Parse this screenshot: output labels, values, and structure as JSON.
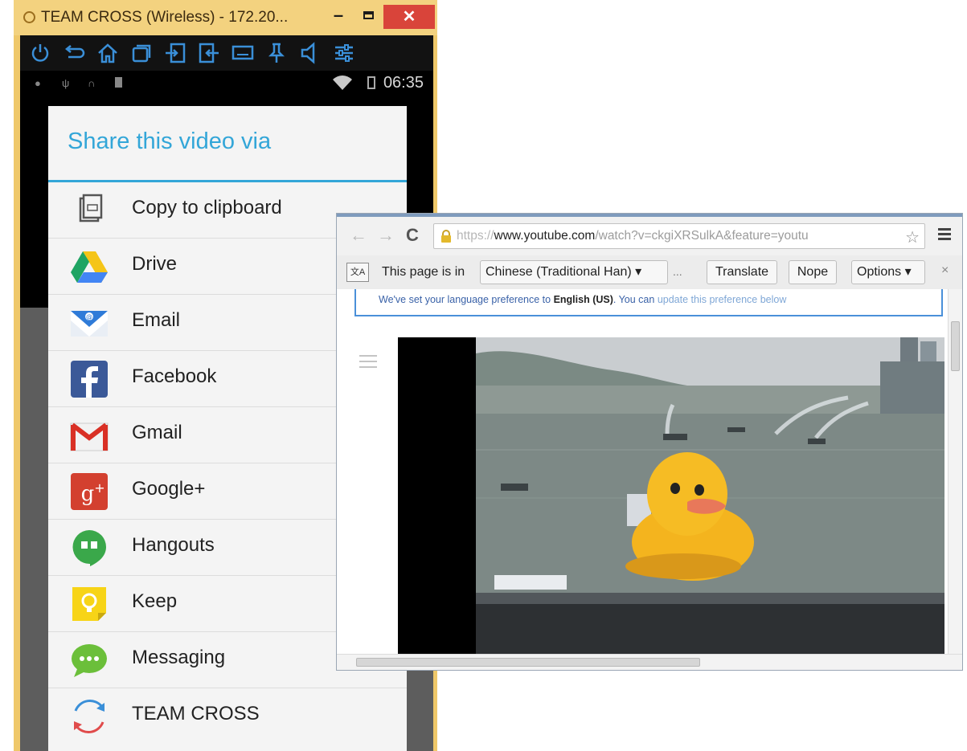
{
  "emulator": {
    "title": "TEAM CROSS (Wireless) - 172.20...",
    "close_label": "✕",
    "minimize_label": "–",
    "toolbar_icons": [
      "power-icon",
      "back-icon",
      "home-icon",
      "recents-icon",
      "import-icon",
      "export-icon",
      "keyboard-icon",
      "pin-icon",
      "volume-icon",
      "settings-sliders-icon"
    ]
  },
  "status_bar": {
    "time": "06:35"
  },
  "share_dialog": {
    "title": "Share this video via",
    "items": [
      {
        "label": "Copy to clipboard",
        "icon": "clipboard-icon"
      },
      {
        "label": "Drive",
        "icon": "drive-icon"
      },
      {
        "label": "Email",
        "icon": "email-icon"
      },
      {
        "label": "Facebook",
        "icon": "facebook-icon"
      },
      {
        "label": "Gmail",
        "icon": "gmail-icon"
      },
      {
        "label": "Google+",
        "icon": "google-plus-icon"
      },
      {
        "label": "Hangouts",
        "icon": "hangouts-icon"
      },
      {
        "label": "Keep",
        "icon": "keep-icon"
      },
      {
        "label": "Messaging",
        "icon": "messaging-icon"
      },
      {
        "label": "TEAM CROSS",
        "icon": "team-cross-icon"
      }
    ]
  },
  "browser": {
    "nav": {
      "back": "←",
      "forward": "→",
      "reload": "C"
    },
    "url": {
      "scheme": "https://",
      "host": "www.youtube.com",
      "path": "/watch?v=ckgiXRSulkA&feature=youtu"
    },
    "star": "☆",
    "translate_bar": {
      "prefix": "This page is in",
      "language": "Chinese (Traditional Han) ▾",
      "more": "...",
      "translate_button": "Translate",
      "nope_button": "Nope",
      "options_button": "Options ▾",
      "close": "×"
    },
    "notice": {
      "part1": "We've set your language preference to",
      "language": "English (US)",
      "part2": ". You can",
      "link": "update this preference below"
    }
  },
  "colors": {
    "emulator_frame": "#efc86a",
    "share_accent": "#33a6d8",
    "close_red": "#d9443a"
  }
}
